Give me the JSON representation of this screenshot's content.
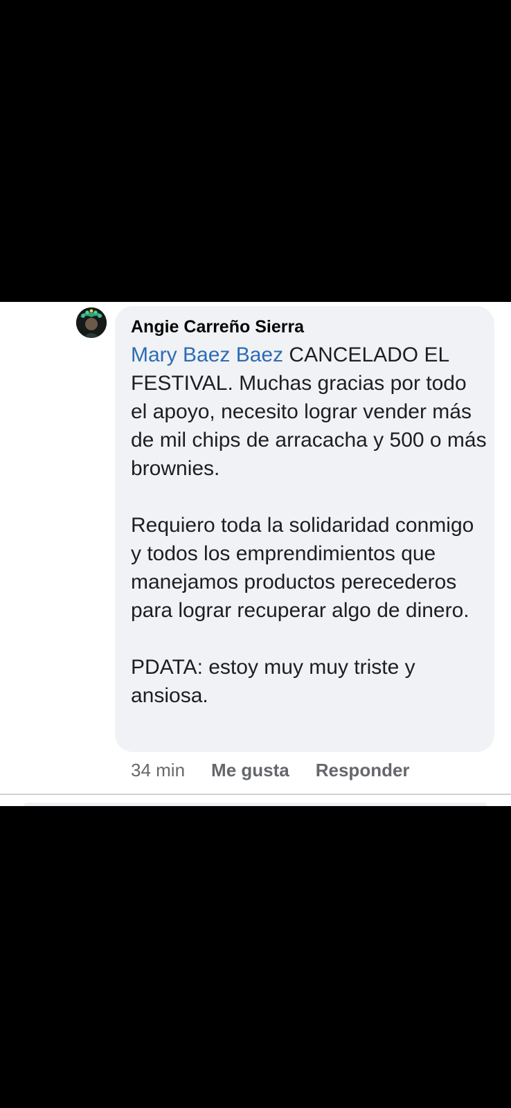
{
  "comment": {
    "author": "Angie Carreño Sierra",
    "mention": "Mary Baez Baez",
    "paragraphs": [
      " CANCELADO EL FESTIVAL. Muchas gracias por todo el apoyo, necesito lograr vender más de mil chips de arracacha y 500 o más brownies.",
      "Requiero toda la solidaridad conmigo y todos los emprendimientos que manejamos productos perecederos para lograr recuperar algo de dinero.",
      "PDATA: estoy muy muy triste y ansiosa."
    ],
    "timestamp": "34 min",
    "like_label": "Me gusta",
    "reply_label": "Responder"
  },
  "colors": {
    "bubble_bg": "#f0f2f5",
    "mention": "#2d6bb4",
    "meta_text": "#65676b"
  },
  "icons": {
    "avatar": "profile-avatar-image"
  }
}
